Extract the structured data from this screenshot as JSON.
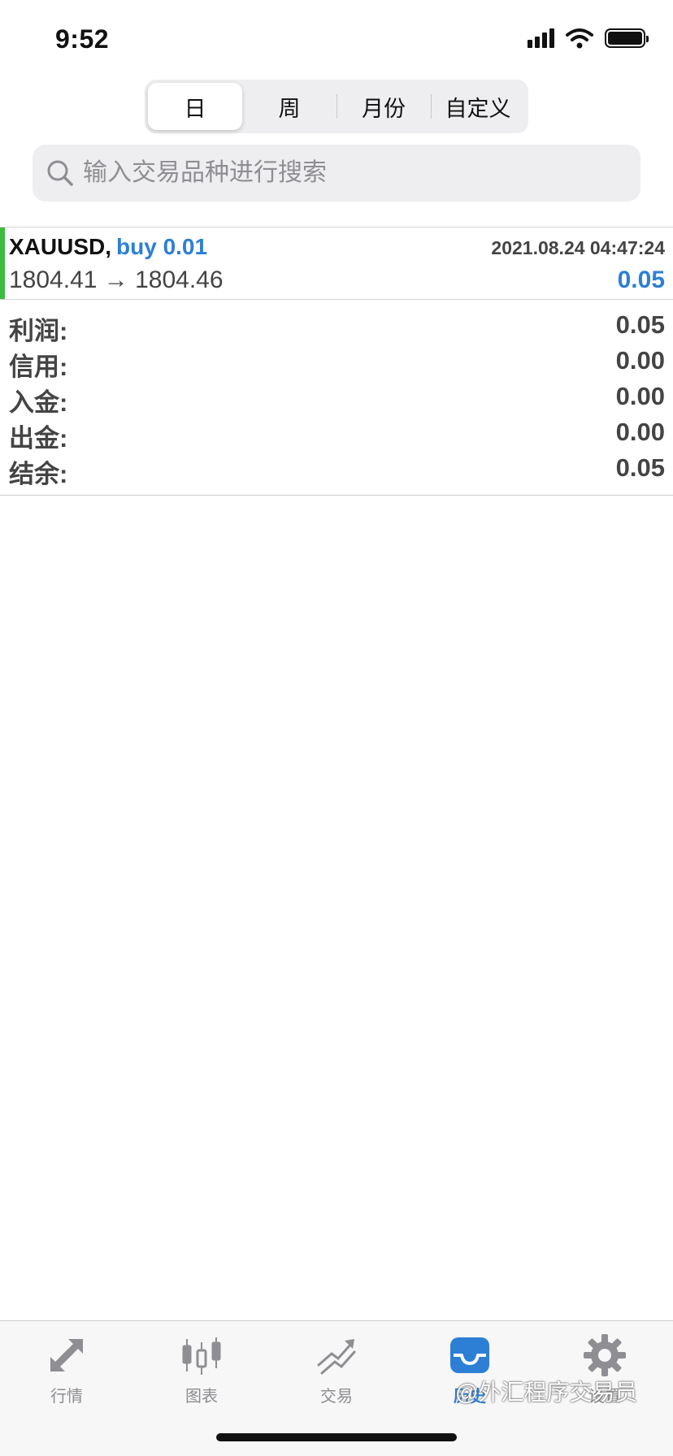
{
  "status_bar": {
    "time": "9:52"
  },
  "segmented": {
    "tabs": [
      {
        "label": "日"
      },
      {
        "label": "周"
      },
      {
        "label": "月份"
      },
      {
        "label": "自定义"
      }
    ],
    "selected": "日"
  },
  "search": {
    "placeholder": "输入交易品种进行搜索"
  },
  "deal": {
    "symbol": "XAUUSD,",
    "direction": "buy 0.01",
    "time": "2021.08.24 04:47:24",
    "prices": "1804.41 → 1804.46",
    "profit": "0.05",
    "accent_color": "#3dbb3d",
    "value_color": "#2d7fd6"
  },
  "summary": [
    {
      "label": "利润:",
      "value": "0.05"
    },
    {
      "label": "信用:",
      "value": "0.00"
    },
    {
      "label": "入金:",
      "value": "0.00"
    },
    {
      "label": "出金:",
      "value": "0.00"
    },
    {
      "label": "结余:",
      "value": "0.05"
    }
  ],
  "tabbar": {
    "items": [
      {
        "label": "行情",
        "icon": "quotes-arrows-icon"
      },
      {
        "label": "图表",
        "icon": "candlestick-chart-icon"
      },
      {
        "label": "交易",
        "icon": "trade-trend-icon"
      },
      {
        "label": "历史",
        "icon": "history-inbox-icon"
      },
      {
        "label": "设置",
        "icon": "gear-icon"
      }
    ],
    "active": "历史",
    "active_color": "#2d7fd6",
    "inactive_color": "#8e8e93"
  },
  "watermark": "@外汇程序交易员"
}
